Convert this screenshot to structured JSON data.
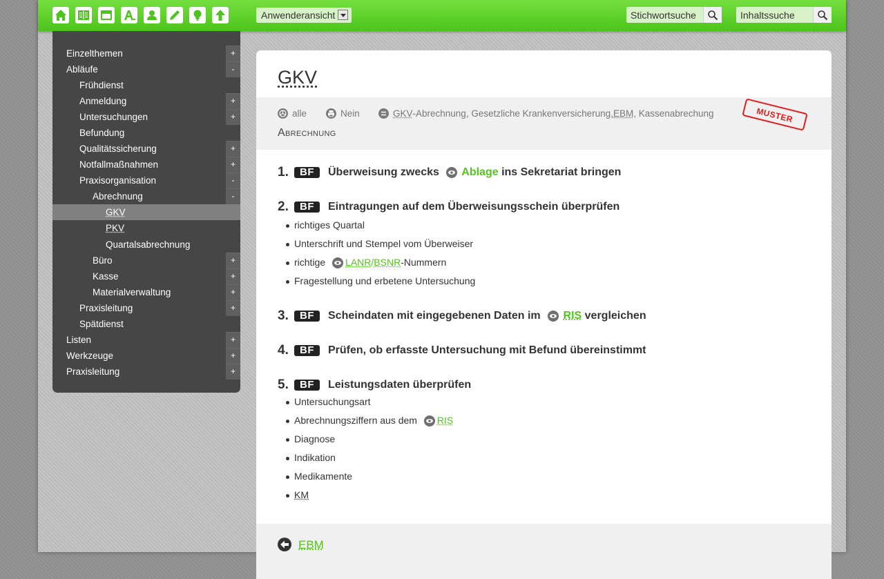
{
  "toolbar": {
    "icons": [
      "home-icon",
      "book-icon",
      "folder-icon",
      "font-icon",
      "user-icon",
      "pencil-icon",
      "lightbulb-icon",
      "arrow-up-icon"
    ],
    "view_select": "Anwenderansicht",
    "search_keyword_placeholder": "Stichwortsuche",
    "search_content_placeholder": "Inhaltssuche"
  },
  "sidebar": {
    "items": [
      {
        "label": "Einzelthemen",
        "toggle": "+"
      },
      {
        "label": "Abläufe",
        "toggle": "-"
      },
      {
        "label": "Frühdienst",
        "toggle": ""
      },
      {
        "label": "Anmeldung",
        "toggle": "+"
      },
      {
        "label": "Untersuchungen",
        "toggle": "+"
      },
      {
        "label": "Befundung",
        "toggle": ""
      },
      {
        "label": "Qualitätssicherung",
        "toggle": "+"
      },
      {
        "label": "Notfallmaßnahmen",
        "toggle": "+"
      },
      {
        "label": "Praxisorganisation",
        "toggle": "-"
      },
      {
        "label": "Abrechnung",
        "toggle": "-"
      },
      {
        "label": "GKV",
        "toggle": ""
      },
      {
        "label": "PKV",
        "toggle": ""
      },
      {
        "label": "Quartalsabrechnung",
        "toggle": ""
      },
      {
        "label": "Büro",
        "toggle": "+"
      },
      {
        "label": "Kasse",
        "toggle": "+"
      },
      {
        "label": "Materialverwaltung",
        "toggle": "+"
      },
      {
        "label": "Praxisleitung",
        "toggle": "+"
      },
      {
        "label": "Spätdienst",
        "toggle": ""
      },
      {
        "label": "Listen",
        "toggle": "+"
      },
      {
        "label": "Werkzeuge",
        "toggle": "+"
      },
      {
        "label": "Praxisleitung",
        "toggle": "+"
      }
    ]
  },
  "page": {
    "title": "GKV",
    "meta": {
      "audience": "alle",
      "print": "Nein",
      "tag_gkv": "GKV",
      "tag_rest1": "-Abrechnung, Gesetzliche Krankenversicherung, ",
      "tag_ebm": "EBM",
      "tag_rest2": ", Kassenabrechung"
    },
    "category": "Abrechnung",
    "stamp": "MUSTER",
    "badge": "BF",
    "steps": [
      {
        "num": "1.",
        "pre": "Überweisung zwecks",
        "link": "Ablage",
        "post": "ins Sekretariat bringen"
      },
      {
        "num": "2.",
        "text": "Eintragungen auf dem Überweisungsschein überprüfen",
        "subs": [
          "richtiges Quartal",
          "Unterschrift und Stempel vom Überweiser",
          "Fragestellung und erbetene Untersuchung"
        ],
        "sub_link": {
          "pre": "richtige",
          "link1": "LANR",
          "sep": "/",
          "link2": "BSNR",
          "post": "-Nummern"
        }
      },
      {
        "num": "3.",
        "pre": "Scheindaten mit eingegebenen Daten im",
        "link": "RIS",
        "post": "vergleichen"
      },
      {
        "num": "4.",
        "text": "Prüfen, ob erfasste Untersuchung mit Befund übereinstimmt"
      },
      {
        "num": "5.",
        "text": "Leistungsdaten überprüfen",
        "subs": [
          "Untersuchungsart",
          "Diagnose",
          "Indikation",
          "Medikamente",
          "KM"
        ],
        "sub_link": {
          "pre": "Abrechnungsziffern aus dem",
          "link": "RIS"
        }
      }
    ],
    "footer_link": "EBM"
  }
}
